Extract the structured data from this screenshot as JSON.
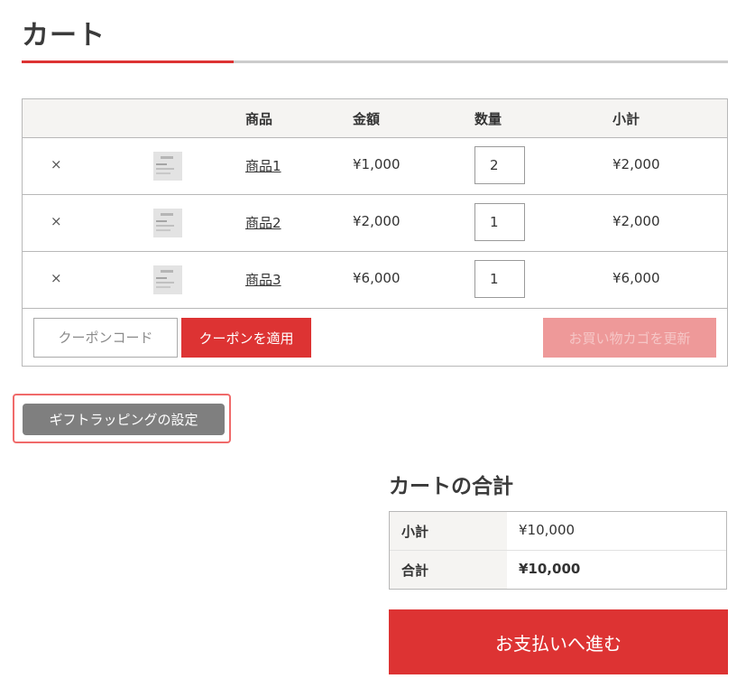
{
  "page_title": "カート",
  "cart": {
    "headers": {
      "product": "商品",
      "price": "金額",
      "quantity": "数量",
      "subtotal": "小計"
    },
    "remove_symbol": "×",
    "items": [
      {
        "name": "商品1",
        "price": "¥1,000",
        "quantity": "2",
        "subtotal": "¥2,000"
      },
      {
        "name": "商品2",
        "price": "¥2,000",
        "quantity": "1",
        "subtotal": "¥2,000"
      },
      {
        "name": "商品3",
        "price": "¥6,000",
        "quantity": "1",
        "subtotal": "¥6,000"
      }
    ],
    "coupon_placeholder": "クーポンコード",
    "apply_coupon_label": "クーポンを適用",
    "update_cart_label": "お買い物カゴを更新"
  },
  "gift_wrapping_label": "ギフトラッピングの設定",
  "totals": {
    "title": "カートの合計",
    "subtotal_label": "小計",
    "subtotal_value": "¥10,000",
    "total_label": "合計",
    "total_value": "¥10,000"
  },
  "checkout_label": "お支払いへ進む",
  "colors": {
    "accent": "#dd3333",
    "accent_disabled": "#ee9999",
    "gift_button": "#7f7f7f",
    "highlight_border": "#f06a6a"
  }
}
